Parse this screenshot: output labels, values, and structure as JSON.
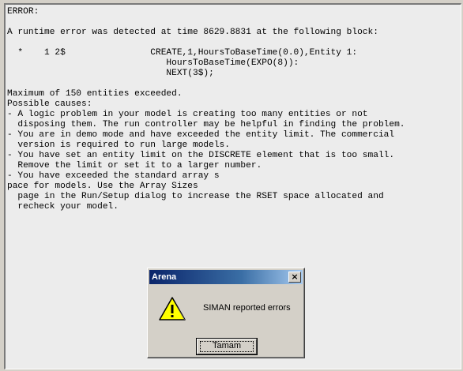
{
  "error_panel": {
    "lines": [
      "ERROR:",
      "",
      "A runtime error was detected at time 8629.8831 at the following block:",
      "",
      "  *    1 2$                CREATE,1,HoursToBaseTime(0.0),Entity 1:",
      "                              HoursToBaseTime(EXPO(8)):",
      "                              NEXT(3$);",
      "",
      "Maximum of 150 entities exceeded.",
      "Possible causes:",
      "- A logic problem in your model is creating too many entities or not",
      "  disposing them. The run controller may be helpful in finding the problem.",
      "- You are in demo mode and have exceeded the entity limit. The commercial",
      "  version is required to run large models.",
      "- You have set an entity limit on the DISCRETE element that is too small.",
      "  Remove the limit or set it to a larger number.",
      "- You have exceeded the standard array s",
      "pace for models. Use the Array Sizes",
      "  page in the Run/Setup dialog to increase the RSET space allocated and",
      "  recheck your model."
    ]
  },
  "dialog": {
    "title": "Arena",
    "close_label": "×",
    "message": "SIMAN reported errors",
    "ok_label": "Tamam",
    "icon": "warning-icon",
    "colors": {
      "title_start": "#0a246a",
      "title_end": "#a6caf0",
      "icon_yellow": "#ffff00"
    }
  }
}
